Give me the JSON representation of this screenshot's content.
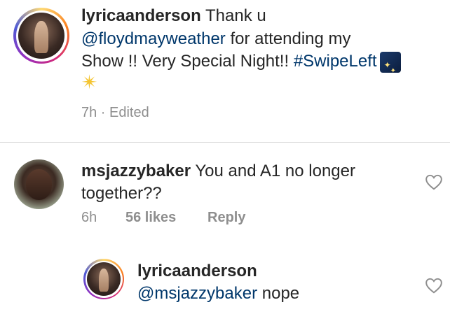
{
  "caption": {
    "username": "lyricaanderson",
    "text_line1": " Thank u",
    "mention": "@floydmayweather",
    "text_line2_rest": " for attending my",
    "text_line3": "Show !! Very Special Night!! ",
    "hashtag": "#SwipeLeft",
    "emoji_1": "stars-emoji",
    "emoji_2": "sparkle-emoji",
    "time": "7h · Edited"
  },
  "comments": [
    {
      "username": "msjazzybaker",
      "text_line1": " You and A1 no longer",
      "text_line2": "together??",
      "time": "6h",
      "likes": "56 likes",
      "reply_label": "Reply"
    },
    {
      "username": "lyricaanderson",
      "mention": "@msjazzybaker",
      "text": " nope"
    }
  ],
  "colors": {
    "link": "#00376b",
    "meta": "#8e8e8e",
    "text": "#262626"
  }
}
